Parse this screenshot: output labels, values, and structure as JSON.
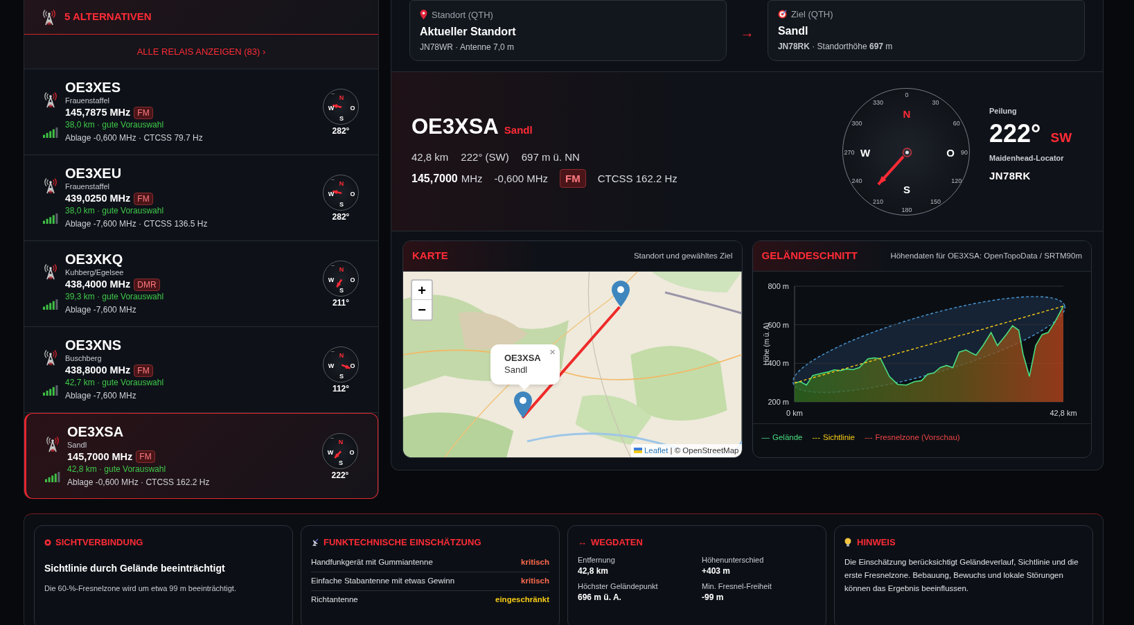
{
  "alternatives": {
    "title": "5 ALTERNATIVEN",
    "show_all": "ALLE RELAIS ANZEIGEN (83) ›"
  },
  "relays": [
    {
      "callsign": "OE3XES",
      "location": "Frauenstaffel",
      "frequency": "145,7875 MHz",
      "mode": "FM",
      "rating": "38,0 km · gute Vorauswahl",
      "details": "Ablage -0,600 MHz · CTCSS 79.7 Hz",
      "bearing": "282°",
      "compass_labels": [
        "N",
        "O",
        "S",
        "W"
      ],
      "selected": false
    },
    {
      "callsign": "OE3XEU",
      "location": "Frauenstaffel",
      "frequency": "439,0250 MHz",
      "mode": "FM",
      "rating": "38,0 km · gute Vorauswahl",
      "details": "Ablage -7,600 MHz · CTCSS 136.5 Hz",
      "bearing": "282°",
      "compass_labels": [
        "N",
        "O",
        "S",
        "W"
      ],
      "selected": false
    },
    {
      "callsign": "OE3XKQ",
      "location": "Kuhberg/Egelsee",
      "frequency": "438,4000 MHz",
      "mode": "DMR",
      "rating": "39,3 km · gute Vorauswahl",
      "details": "Ablage -7,600 MHz",
      "bearing": "211°",
      "compass_labels": [
        "N",
        "O",
        "S",
        "W"
      ],
      "selected": false
    },
    {
      "callsign": "OE3XNS",
      "location": "Buschberg",
      "frequency": "438,8000 MHz",
      "mode": "FM",
      "rating": "42,7 km · gute Vorauswahl",
      "details": "Ablage -7,600 MHz",
      "bearing": "112°",
      "compass_labels": [
        "N",
        "O",
        "S",
        "W"
      ],
      "selected": false
    },
    {
      "callsign": "OE3XSA",
      "location": "Sandl",
      "frequency": "145,7000 MHz",
      "mode": "FM",
      "rating": "42,8 km · gute Vorauswahl",
      "details": "Ablage -0,600 MHz · CTCSS 162.2 Hz",
      "bearing": "222°",
      "compass_labels": [
        "N",
        "O",
        "S",
        "W"
      ],
      "selected": true
    }
  ],
  "route": {
    "from": {
      "label": "Standort (QTH)",
      "name": "Aktueller Standort",
      "detail": "JN78WR · Antenne 7,0 m"
    },
    "arrow": "→",
    "to": {
      "label": "Ziel (QTH)",
      "name": "Sandl",
      "detail": "**JN78RK** · Standorthöhe **697** m"
    }
  },
  "target": {
    "callsign": "OE3XSA",
    "name": "Sandl",
    "distance": "42,8 km",
    "bearing": "222° (SW)",
    "altitude": "697 m ü. NN",
    "frequency": "145,7000",
    "frequency_unit": "MHz",
    "offset": "-0,600 MHz",
    "mode": "FM",
    "ctcss": "CTCSS 162.2 Hz"
  },
  "compass": {
    "degree_labels": [
      "0",
      "30",
      "60",
      "90",
      "120",
      "150",
      "180",
      "210",
      "240",
      "270",
      "300",
      "330"
    ],
    "cardinals": [
      "N",
      "O",
      "S",
      "W"
    ],
    "bearing_label": "Peilung",
    "bearing": "222°",
    "direction": "SW",
    "locator_label": "Maidenhead-Locator",
    "locator": "JN78RK"
  },
  "map": {
    "title": "KARTE",
    "subtitle": "Standort und gewähltes Ziel",
    "zoom_in": "+",
    "zoom_out": "−",
    "popup": {
      "title": "OE3XSA",
      "subtitle": "Sandl",
      "close": "×"
    },
    "attribution_link": "Leaflet",
    "attribution": "| © OpenStreetMap"
  },
  "profile": {
    "title": "GELÄNDESCHNITT",
    "subtitle": "Höhendaten für OE3XSA: OpenTopoData / SRTM90m",
    "chart_data": {
      "type": "area",
      "ylabel": "Höhe (m ü. A)",
      "ylim": [
        200,
        800
      ],
      "xlim": [
        0,
        42.8
      ],
      "yticks": [
        {
          "value": 200,
          "label": "200 m"
        },
        {
          "value": 400,
          "label": "400 m"
        },
        {
          "value": 600,
          "label": "600 m"
        },
        {
          "value": 800,
          "label": "800 m"
        }
      ],
      "xticks": [
        {
          "value": 0,
          "label": "0 km"
        },
        {
          "value": 42.8,
          "label": "42,8 km"
        }
      ],
      "x": [
        0,
        0.9,
        1.9,
        2.9,
        4.3,
        5.3,
        6.3,
        7.3,
        8.3,
        9.3,
        10.3,
        11.7,
        12.7,
        13.7,
        15.1,
        16.4,
        17.8,
        19.1,
        20.2,
        21.2,
        22.2,
        23.2,
        24.2,
        25.2,
        26.2,
        27.3,
        28.3,
        28.9,
        30.0,
        31.3,
        32.3,
        33.7,
        34.7,
        35.7,
        36.4,
        37.4,
        38.4,
        39.4,
        40.4,
        41.5,
        42.8
      ],
      "series": [
        {
          "name": "Gelände",
          "color": "#4ade80",
          "values": [
            298,
            305,
            287,
            337,
            348,
            355,
            366,
            362,
            371,
            367,
            378,
            424,
            428,
            424,
            332,
            291,
            287,
            305,
            310,
            344,
            351,
            378,
            389,
            378,
            458,
            469,
            451,
            442,
            492,
            560,
            492,
            549,
            595,
            572,
            446,
            332,
            492,
            549,
            560,
            617,
            697
          ]
        },
        {
          "name": "Sichtlinie",
          "type": "line",
          "line_style": "dashed",
          "color": "#facc15",
          "values": [
            298,
            306,
            316,
            325,
            338,
            347,
            357,
            366,
            375,
            385,
            394,
            407,
            416,
            426,
            439,
            451,
            464,
            476,
            486,
            495,
            505,
            514,
            524,
            533,
            543,
            552,
            561,
            568,
            577,
            590,
            599,
            612,
            621,
            631,
            637,
            647,
            656,
            665,
            675,
            684,
            697
          ]
        }
      ]
    },
    "legend_symbols": [
      "—",
      "---"
    ],
    "fresnel_legend": {
      "symbol": "---",
      "label": "Fresnelzone (Vorschau)",
      "color": "#ef4444"
    }
  },
  "sight": {
    "title": "SICHTVERBINDUNG",
    "headline": "Sichtlinie durch Gelände beeinträchtigt",
    "text": "Die 60-%-Fresnelzone wird um etwa 99 m beeinträchtigt."
  },
  "assessment": {
    "title": "FUNKTECHNISCHE EINSCHÄTZUNG",
    "rows": [
      {
        "label": "Handfunkgerät mit Gummiantenne",
        "rating": "kritisch",
        "color": "#ff6a4d"
      },
      {
        "label": "Einfache Stabantenne mit etwas Gewinn",
        "rating": "kritisch",
        "color": "#ff6a4d"
      },
      {
        "label": "Richtantenne",
        "rating": "eingeschränkt",
        "color": "#facc15"
      }
    ]
  },
  "path": {
    "icon": "↔",
    "title": "WEGDATEN",
    "items": [
      {
        "label": "Entfernung",
        "value": "42,8 km"
      },
      {
        "label": "Höhenunterschied",
        "value": "+403 m"
      },
      {
        "label": "Höchster Geländepunkt",
        "value": "696 m ü. A."
      },
      {
        "label": "Min. Fresnel-Freiheit",
        "value": "-99 m"
      }
    ]
  },
  "hint": {
    "title": "HINWEIS",
    "text": "Die Einschätzung berücksichtigt Geländeverlauf, Sichtlinie und die erste Fresnelzone. Bebauung, Bewuchs und lokale Störungen können das Ergebnis beeinflussen."
  }
}
